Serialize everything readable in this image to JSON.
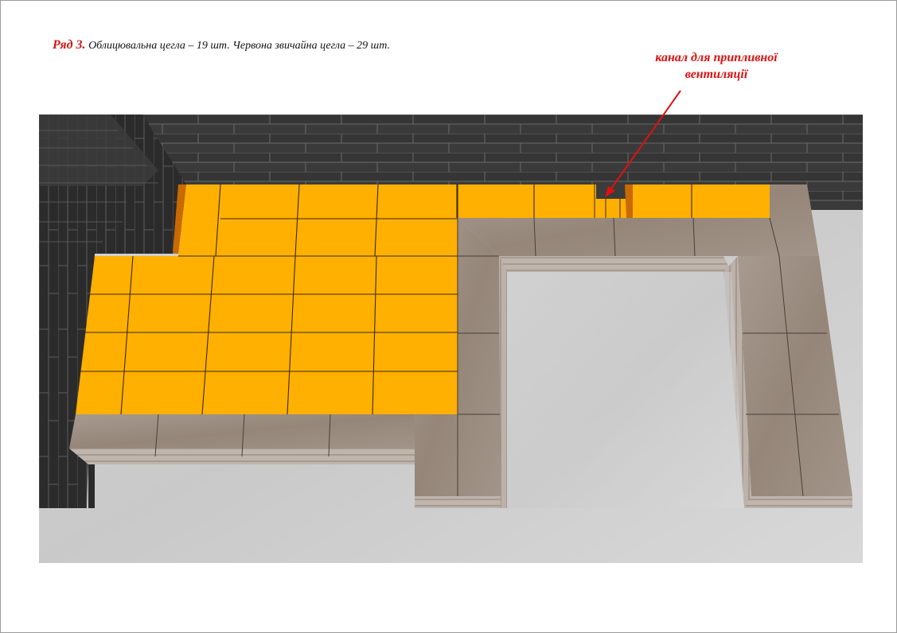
{
  "caption": {
    "row_label": "Ряд 3.",
    "text": "Облицювальна цегла – 19 шт. Червона звичайна цегла – 29 шт."
  },
  "callout": {
    "line1": "канал для припливної",
    "line2": "вентиляції"
  },
  "colors": {
    "brick_fill": "#ffb000",
    "facing_brick": "#9e8f84",
    "wall_dark": "#2e2e2e",
    "floor": "#cfcfcf",
    "annotation": "#e01010"
  }
}
